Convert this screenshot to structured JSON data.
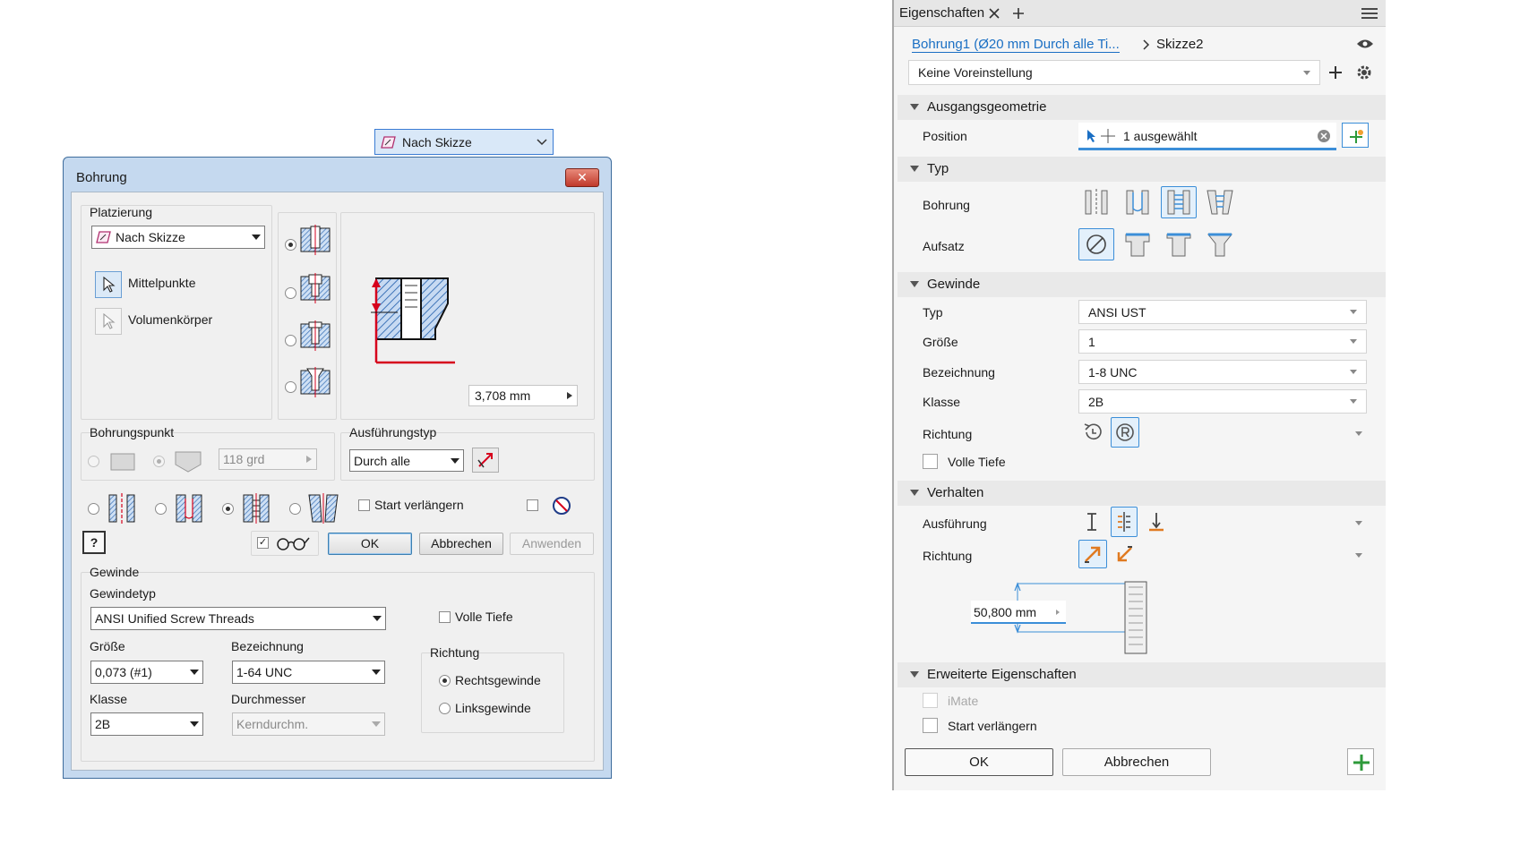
{
  "floating_combo": {
    "value": "Nach Skizze"
  },
  "dialog": {
    "title": "Bohrung",
    "close": "✕",
    "placement": {
      "group_label": "Platzierung",
      "combo_value": "Nach Skizze",
      "mittelpunkte": "Mittelpunkte",
      "volumenkoerper": "Volumenkörper"
    },
    "preview": {
      "dimension": "3,708 mm"
    },
    "bohrungspunkt": {
      "label": "Bohrungspunkt",
      "angle": "118 grd"
    },
    "ausfuehrungstyp": {
      "label": "Ausführungstyp",
      "value": "Durch alle"
    },
    "start_verlaengern": "Start verlängern",
    "buttons": {
      "ok": "OK",
      "abbrechen": "Abbrechen",
      "anwenden": "Anwenden",
      "help": "?"
    },
    "gewinde": {
      "group_label": "Gewinde",
      "gewindetyp_label": "Gewindetyp",
      "gewindetyp_value": "ANSI Unified Screw Threads",
      "volle_tiefe": "Volle Tiefe",
      "groesse_label": "Größe",
      "groesse_value": "0,073 (#1)",
      "bezeichnung_label": "Bezeichnung",
      "bezeichnung_value": "1-64 UNC",
      "klasse_label": "Klasse",
      "klasse_value": "2B",
      "durchmesser_label": "Durchmesser",
      "durchmesser_value": "Kerndurchm.",
      "richtung_label": "Richtung",
      "rechts": "Rechtsgewinde",
      "links": "Linksgewinde"
    }
  },
  "panel": {
    "tab_title": "Eigenschaften",
    "breadcrumb_link": "Bohrung1 (Ø20 mm Durch alle Ti...",
    "breadcrumb_current": "Skizze2",
    "preset": "Keine Voreinstellung",
    "sections": {
      "ausgangsgeometrie": "Ausgangsgeometrie",
      "typ": "Typ",
      "gewinde": "Gewinde",
      "verhalten": "Verhalten",
      "erweitert": "Erweiterte Eigenschaften"
    },
    "position_label": "Position",
    "position_value": "1 ausgewählt",
    "bohrung_label": "Bohrung",
    "aufsatz_label": "Aufsatz",
    "typ_label": "Typ",
    "typ_value": "ANSI UST",
    "groesse_label": "Größe",
    "groesse_value": "1",
    "bezeichnung_label": "Bezeichnung",
    "bezeichnung_value": "1-8 UNC",
    "klasse_label": "Klasse",
    "klasse_value": "2B",
    "richtung_label": "Richtung",
    "volle_tiefe": "Volle Tiefe",
    "ausfuehrung_label": "Ausführung",
    "richtung2_label": "Richtung",
    "depth_value": "50,800 mm",
    "imate": "iMate",
    "start_verlaengern": "Start verlängern",
    "ok": "OK",
    "abbrechen": "Abbrechen"
  },
  "colors": {
    "accent": "#3b8ed8",
    "link": "#1a6fc4",
    "dimension_red": "#d6001c",
    "hatch_blue": "#5b8fc9"
  }
}
